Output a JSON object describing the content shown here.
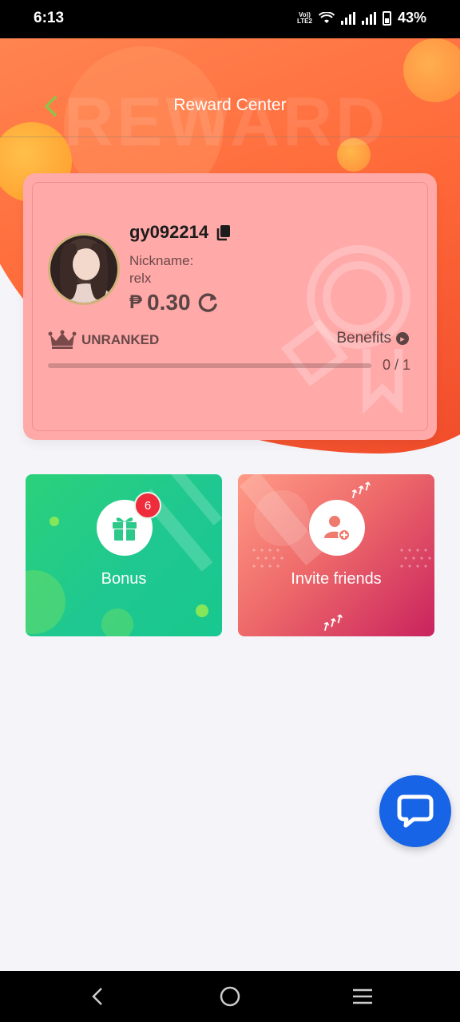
{
  "status_bar": {
    "time": "6:13",
    "volte_line1": "Vo))",
    "volte_line2": "LTE2",
    "battery": "43%"
  },
  "header": {
    "title": "Reward Center",
    "watermark": "REWARD",
    "back_icon": "chevron-left-icon"
  },
  "profile": {
    "username": "gy092214",
    "copy_icon": "copy-icon",
    "nickname_label": "Nickname:",
    "nickname": "relx",
    "currency_symbol": "₱",
    "balance": "0.30",
    "refresh_icon": "refresh-icon",
    "rank": "UNRANKED",
    "benefits_label": "Benefits",
    "progress_text": "0 / 1",
    "progress_value": 0
  },
  "tiles": {
    "bonus": {
      "label": "Bonus",
      "badge": "6",
      "icon": "gift-icon"
    },
    "invite": {
      "label": "Invite friends",
      "icon": "add-user-icon"
    }
  },
  "chat": {
    "icon": "chat-bubble-icon"
  },
  "nav": {
    "back": "back-icon",
    "home": "home-icon",
    "menu": "menu-icon"
  },
  "colors": {
    "header_orange": "#ff6a3a",
    "card_pink": "#ffa9a9",
    "bonus_green": "#1fc890",
    "invite_pink": "#c9235e",
    "chat_blue": "#1764e6",
    "badge_red": "#ee2c3c"
  }
}
